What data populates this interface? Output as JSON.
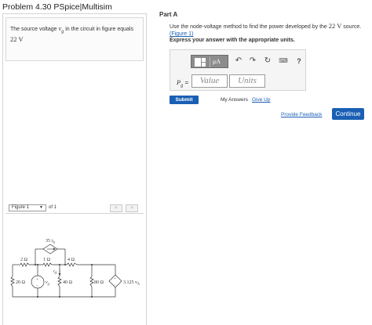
{
  "header": {
    "title": "Problem 4.30 PSpice|Multisim"
  },
  "problem": {
    "statement_pre": "The source voltage ",
    "statement_var": "v",
    "statement_sub": "g",
    "statement_mid": " in the circuit in figure equals ",
    "statement_value": "22",
    "statement_unit": "V"
  },
  "figure_nav": {
    "selected": "Figure 1",
    "of_text": "of 1",
    "prev_glyph": "<",
    "next_glyph": ">"
  },
  "circuit": {
    "dep_current_label": "35 i",
    "dep_current_sub": "Δ",
    "r_top_left": "2 Ω",
    "r_top_mid": "1 Ω",
    "r_top_right": "4 Ω",
    "r_left": "20 Ω",
    "src_label": "v",
    "src_sub": "g",
    "i_label": "i",
    "i_sub": "Δ",
    "r_mid": "40 Ω",
    "r_right": "80 Ω",
    "dep_src_label": "3.125 v",
    "dep_src_sub": "Δ",
    "plus": "+",
    "minus": "−"
  },
  "part": {
    "label": "Part A",
    "question_pre": "Use the node-voltage method to find the power developed by the ",
    "question_value": "22",
    "question_unit": "V",
    "question_post": " source.",
    "figure_link": "(Figure 1)",
    "instruction": "Express your answer with the appropriate units."
  },
  "answer": {
    "units_button": "μA",
    "var_label": "P",
    "var_sub": "g",
    "equals": "=",
    "value_placeholder": "Value",
    "units_placeholder": "Units",
    "help": "?"
  },
  "actions": {
    "submit": "Submit",
    "my_answers": "My Answers",
    "give_up": "Give Up",
    "feedback": "Provide Feedback",
    "continue": "Continue"
  },
  "icons": {
    "undo": "undo-icon",
    "redo": "redo-icon",
    "reset": "reset-icon",
    "keyboard": "keyboard-icon",
    "help": "help-icon"
  },
  "colors": {
    "link": "#1a5fb4",
    "button": "#1a5fb4",
    "toolbar": "#8c8c8c"
  }
}
